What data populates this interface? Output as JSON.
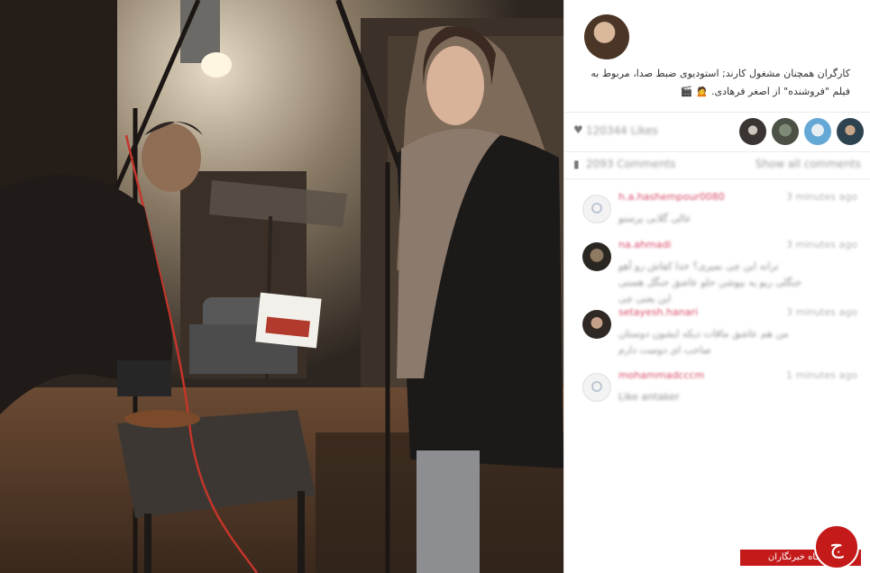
{
  "post": {
    "caption_line1": "کارگران همچنان مشغول کارند; استودیوی ضبط صدا، مربوط به",
    "caption_line2": "فیلم \"فروشنده\" از اصغر فرهادی. 🙍 🎬"
  },
  "stats": {
    "likes": "120344 Likes",
    "comments": "2093 Comments",
    "show_all": "Show all comments"
  },
  "comments": [
    {
      "user": "h.a.hashempour0080",
      "time": "3 minutes ago",
      "text": "عالی گلابی پرستو"
    },
    {
      "user": "na.ahmadi",
      "time": "3 minutes ago",
      "text": "ترانه این چی نمیری؟ خدا کفاش رو آهو جنگلی ریو یه بپوشن حلو عاشق جنگل هستی این یعنی چی"
    },
    {
      "user": "setayesh.hanari",
      "time": "3 minutes ago",
      "text": "من هم عاشق ماقات دیکه ایشون دوستان صاحب ای دوست دارم"
    },
    {
      "user": "mohammadcccm",
      "time": "1 minutes ago",
      "text": "Like antaker"
    }
  ],
  "watermark": {
    "text": "باشگاه خبرنگاران",
    "mark": "ج"
  },
  "icons": {
    "heart": "heart-icon",
    "comment": "comment-icon"
  },
  "colors": {
    "username": "#d94c6a",
    "watermark": "#c41a1a"
  }
}
